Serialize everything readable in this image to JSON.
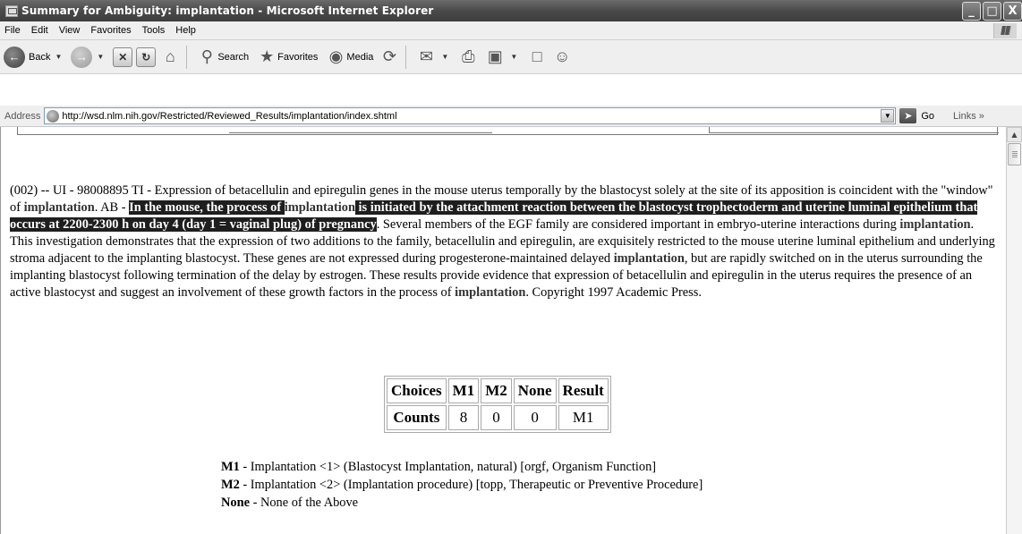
{
  "window": {
    "title": "Summary for Ambiguity: implantation - Microsoft Internet Explorer",
    "minimize": "_",
    "maximize": "□",
    "close": "X"
  },
  "menu": [
    "File",
    "Edit",
    "View",
    "Favorites",
    "Tools",
    "Help"
  ],
  "toolbar": {
    "back_label": "Back",
    "search_label": "Search",
    "favorites_label": "Favorites",
    "media_label": "Media"
  },
  "address": {
    "label": "Address",
    "url": "http://wsd.nlm.nih.gov/Restricted/Reviewed_Results/implantation/index.shtml",
    "go_label": "Go",
    "links_label": "Links »"
  },
  "article": {
    "intro": "(002) -- UI - 98008895 TI - Expression of betacellulin and epiregulin genes in the mouse uterus temporally by the blastocyst solely at the site of its apposition is coincident with the \"window\" of ",
    "kw1": "implantation",
    "mid1": ". AB - ",
    "hl_a": "In the mouse, the process of ",
    "hl_kw": "implantation",
    "hl_b": " is initiated by the attachment reaction between the blastocyst trophectoderm and uterine luminal epithelium that occurs at 2200-2300 h on day 4 (day 1 = vaginal plug) of pregnancy",
    "mid2": ". Several members of the EGF family are considered important in embryo-uterine interactions during ",
    "kw2": "implantation",
    "mid3": ". This investigation demonstrates that the expression of two additions to the family, betacellulin and epiregulin, are exquisitely restricted to the mouse uterine luminal epithelium and underlying stroma adjacent to the implanting blastocyst. These genes are not expressed during progesterone-maintained delayed ",
    "kw3": "implantation",
    "mid4": ", but are rapidly switched on in the uterus surrounding the implanting blastocyst following termination of the delay by estrogen. These results provide evidence that expression of betacellulin and epiregulin in the uterus requires the presence of an active blastocyst and suggest an involvement of these growth factors in the process of ",
    "kw4": "implantation",
    "end": ". Copyright 1997 Academic Press."
  },
  "counts_table": {
    "header": [
      "Choices",
      "M1",
      "M2",
      "None",
      "Result"
    ],
    "row": [
      "Counts",
      "8",
      "0",
      "0",
      "M1"
    ]
  },
  "legend": [
    {
      "key": "M1",
      "text": " - Implantation <1> (Blastocyst Implantation, natural) [orgf, Organism Function]"
    },
    {
      "key": "M2",
      "text": " - Implantation <2> (Implantation procedure) [topp, Therapeutic or Preventive Procedure]"
    },
    {
      "key": "None",
      "text": " - None of the Above"
    }
  ]
}
